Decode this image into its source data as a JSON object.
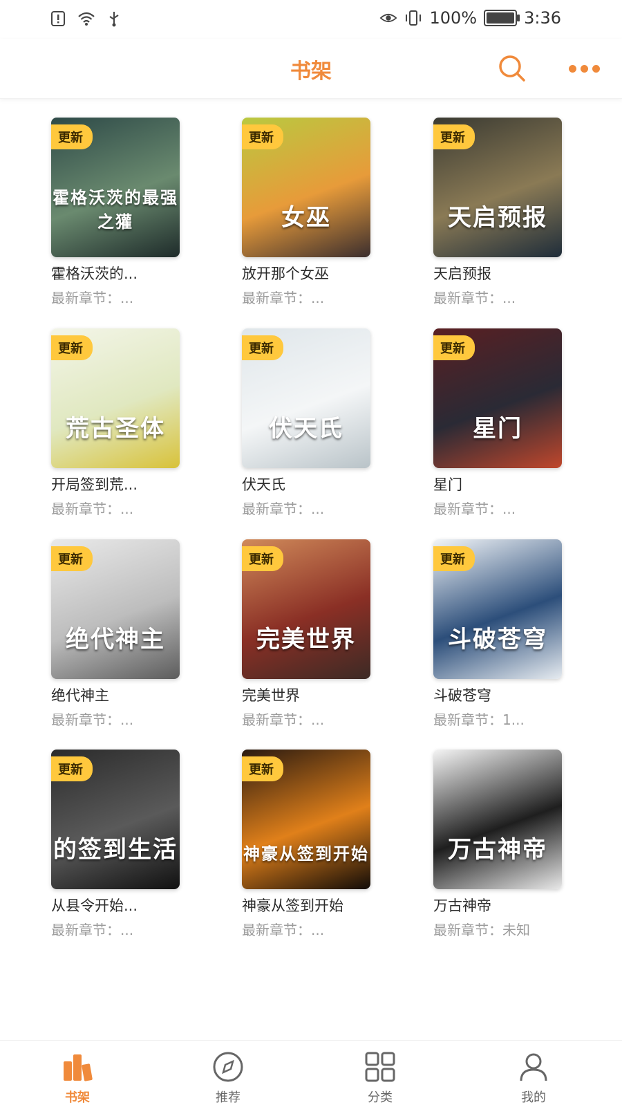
{
  "status_bar": {
    "battery_percent": "100%",
    "time": "3:36",
    "icons": [
      "alert-icon",
      "wifi-icon",
      "usb-icon",
      "eye-icon",
      "vibrate-icon",
      "battery-icon"
    ]
  },
  "header": {
    "title": "书架",
    "accent_color": "#f08a3b"
  },
  "books": [
    {
      "title": "霍格沃茨的...",
      "subtitle": "最新章节：...",
      "badge": "更新",
      "cover_text": "霍格沃茨的最强之獾",
      "cover_colors": [
        "#2e4a48",
        "#6a8a6f",
        "#1e2b2a"
      ]
    },
    {
      "title": "放开那个女巫",
      "subtitle": "最新章节：...",
      "badge": "更新",
      "cover_text": "女巫",
      "cover_colors": [
        "#b9c940",
        "#e79b3a",
        "#3b2e2e"
      ]
    },
    {
      "title": "天启预报",
      "subtitle": "最新章节：...",
      "badge": "更新",
      "cover_text": "天启预报",
      "cover_colors": [
        "#3a3a32",
        "#8a7a55",
        "#1f2d3a"
      ]
    },
    {
      "title": "开局签到荒...",
      "subtitle": "最新章节：...",
      "badge": "更新",
      "cover_text": "荒古圣体",
      "cover_colors": [
        "#f3f5e8",
        "#e0e8c0",
        "#d8c23a"
      ]
    },
    {
      "title": "伏天氏",
      "subtitle": "最新章节：...",
      "badge": "更新",
      "cover_text": "伏天氏",
      "cover_colors": [
        "#dfe6ea",
        "#f4f6f7",
        "#b9c3c8"
      ]
    },
    {
      "title": "星门",
      "subtitle": "最新章节：...",
      "badge": "更新",
      "cover_text": "星门",
      "cover_colors": [
        "#5a1f22",
        "#2a2a35",
        "#c0472c"
      ]
    },
    {
      "title": "绝代神主",
      "subtitle": "最新章节：...",
      "badge": "更新",
      "cover_text": "绝代神主",
      "cover_colors": [
        "#e9e9e9",
        "#bdbdbd",
        "#5c5c5c"
      ]
    },
    {
      "title": "完美世界",
      "subtitle": "最新章节：...",
      "badge": "更新",
      "cover_text": "完美世界",
      "cover_colors": [
        "#d08a5a",
        "#8a2f25",
        "#3c2a25"
      ]
    },
    {
      "title": "斗破苍穹",
      "subtitle": "最新章节：1...",
      "badge": "更新",
      "cover_text": "斗破苍穹",
      "cover_colors": [
        "#f2f5f8",
        "#2c4e7a",
        "#e6ebf0"
      ]
    },
    {
      "title": "从县令开始...",
      "subtitle": "最新章节：...",
      "badge": "更新",
      "cover_text": "的签到生活",
      "cover_colors": [
        "#2b2b2b",
        "#5a5a5a",
        "#111111"
      ]
    },
    {
      "title": "神豪从签到开始",
      "subtitle": "最新章节：...",
      "badge": "更新",
      "cover_text": "神豪从签到开始",
      "cover_colors": [
        "#2a1a10",
        "#e0801a",
        "#120c08"
      ]
    },
    {
      "title": "万古神帝",
      "subtitle": "最新章节：未知",
      "badge": "",
      "cover_text": "万古神帝",
      "cover_colors": [
        "#f5f5f5",
        "#1e1e1e",
        "#e8e8e8"
      ]
    }
  ],
  "bottom_nav": {
    "items": [
      {
        "label": "书架",
        "icon": "bookshelf-icon",
        "active": true
      },
      {
        "label": "推荐",
        "icon": "compass-icon",
        "active": false
      },
      {
        "label": "分类",
        "icon": "grid-icon",
        "active": false
      },
      {
        "label": "我的",
        "icon": "user-icon",
        "active": false
      }
    ]
  }
}
